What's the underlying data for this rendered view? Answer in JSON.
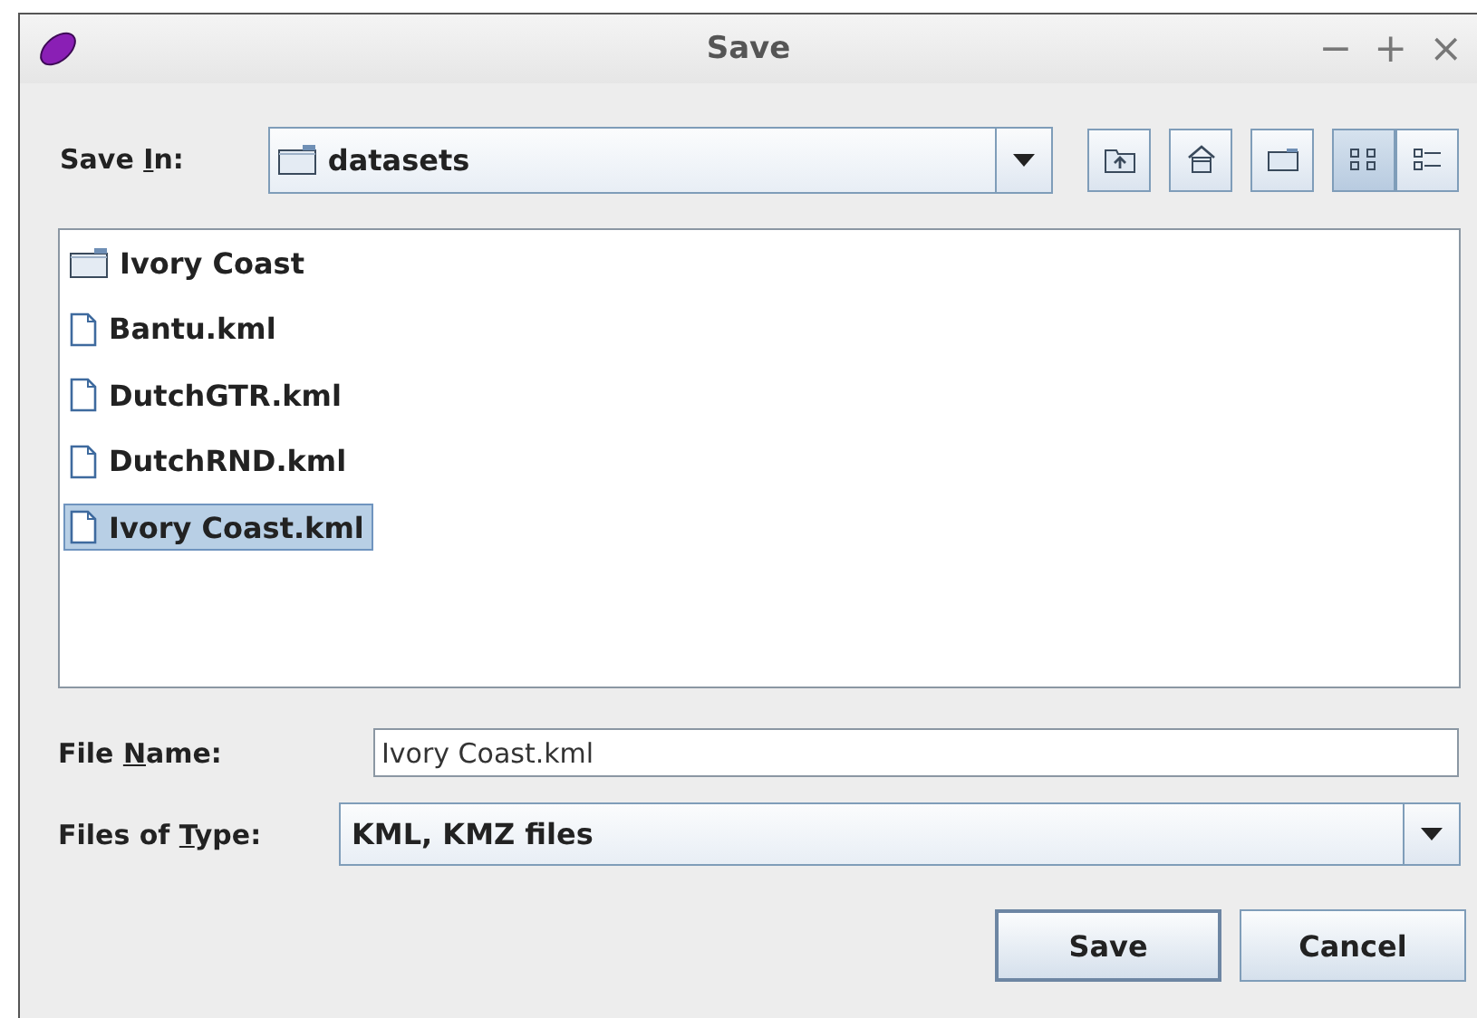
{
  "window": {
    "title": "Save",
    "controls": [
      "−",
      "+",
      "×"
    ]
  },
  "save_in": {
    "label": {
      "before": "Save ",
      "key": "I",
      "after": "n:"
    },
    "value": "datasets"
  },
  "toolbar": [
    {
      "kind": "up",
      "selected": false
    },
    {
      "kind": "home",
      "selected": false
    },
    {
      "kind": "newfolder",
      "selected": false
    },
    {
      "kind": "list",
      "selected": true
    },
    {
      "kind": "details",
      "selected": false
    }
  ],
  "files": [
    {
      "name": "Ivory Coast",
      "kind": "folder",
      "selected": false
    },
    {
      "name": "Bantu.kml",
      "kind": "file",
      "selected": false
    },
    {
      "name": "DutchGTR.kml",
      "kind": "file",
      "selected": false
    },
    {
      "name": "DutchRND.kml",
      "kind": "file",
      "selected": false
    },
    {
      "name": "Ivory Coast.kml",
      "kind": "file",
      "selected": true
    }
  ],
  "file_name": {
    "label": {
      "before": "File ",
      "key": "N",
      "after": "ame:"
    },
    "value": "Ivory Coast.kml"
  },
  "file_type": {
    "label": {
      "before": "Files of ",
      "key": "T",
      "after": "ype:"
    },
    "value": "KML, KMZ files"
  },
  "buttons": [
    "Save",
    "Cancel"
  ]
}
